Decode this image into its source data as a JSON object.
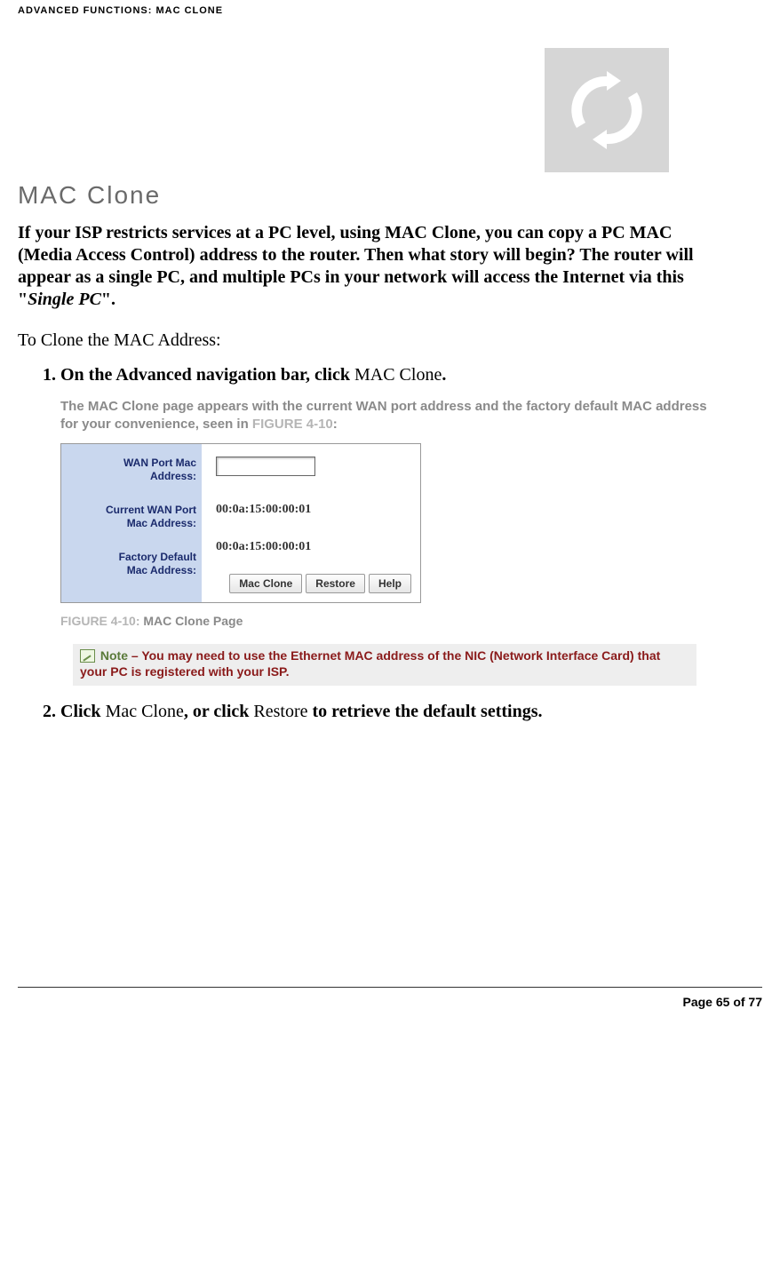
{
  "header": {
    "breadcrumb": "ADVANCED FUNCTIONS: MAC CLONE"
  },
  "title": "MAC Clone",
  "intro": {
    "part1": "If your ISP restricts services at a PC level, using MAC Clone, you can copy a PC MAC (Media Access Control) address to the router. Then what story will begin? The router will appear as a single PC, and multiple PCs in your network will access the Internet via this \"",
    "italic": "Single PC",
    "part2": "\"."
  },
  "lead_in": "To Clone the MAC Address:",
  "steps": {
    "s1": {
      "bold1": "On the Advanced navigation bar, click ",
      "normal": "MAC Clone",
      "bold2": "."
    },
    "sub_gray": {
      "line": "The MAC Clone page appears with the current WAN port address and the factory default MAC address for your convenience, seen in ",
      "ref": "FIGURE 4-10",
      "tail": ":"
    },
    "s2": {
      "b1": "Click ",
      "n1": "Mac Clone",
      "b2": ", or click ",
      "n2": "Restore",
      "b3": " to retrieve the default settings."
    }
  },
  "figure": {
    "labels": {
      "wan_port": "WAN Port Mac Address:",
      "current": "Current WAN Port Mac Address:",
      "factory": "Factory Default Mac Address:"
    },
    "values": {
      "current": "00:0a:15:00:00:01",
      "factory": "00:0a:15:00:00:01"
    },
    "buttons": {
      "clone": "Mac Clone",
      "restore": "Restore",
      "help": "Help"
    },
    "caption": {
      "ref": "FIGURE 4-10",
      "sep": ": ",
      "title": "MAC Clone Page"
    }
  },
  "note": {
    "label": "Note",
    "body": " – You may need to use the Ethernet MAC address of the NIC (Network Interface Card) that your PC is registered with your ISP."
  },
  "footer": {
    "text": "Page 65 of 77"
  }
}
